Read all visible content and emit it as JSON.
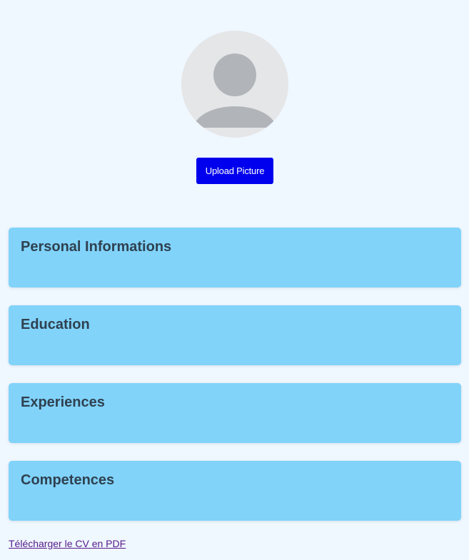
{
  "profile": {
    "avatar_icon": "default-user-avatar-icon",
    "upload_button_label": "Upload Picture"
  },
  "sections": [
    {
      "title": "Personal Informations"
    },
    {
      "title": "Education"
    },
    {
      "title": "Experiences"
    },
    {
      "title": "Competences"
    }
  ],
  "download_link": {
    "label": "Télécharger le CV en PDF"
  },
  "colors": {
    "page_background": "#eff7ff",
    "upload_button": "#0000ee",
    "section_background": "#81d3fa",
    "section_title": "#2f4150",
    "visited_link": "#551a8b"
  }
}
